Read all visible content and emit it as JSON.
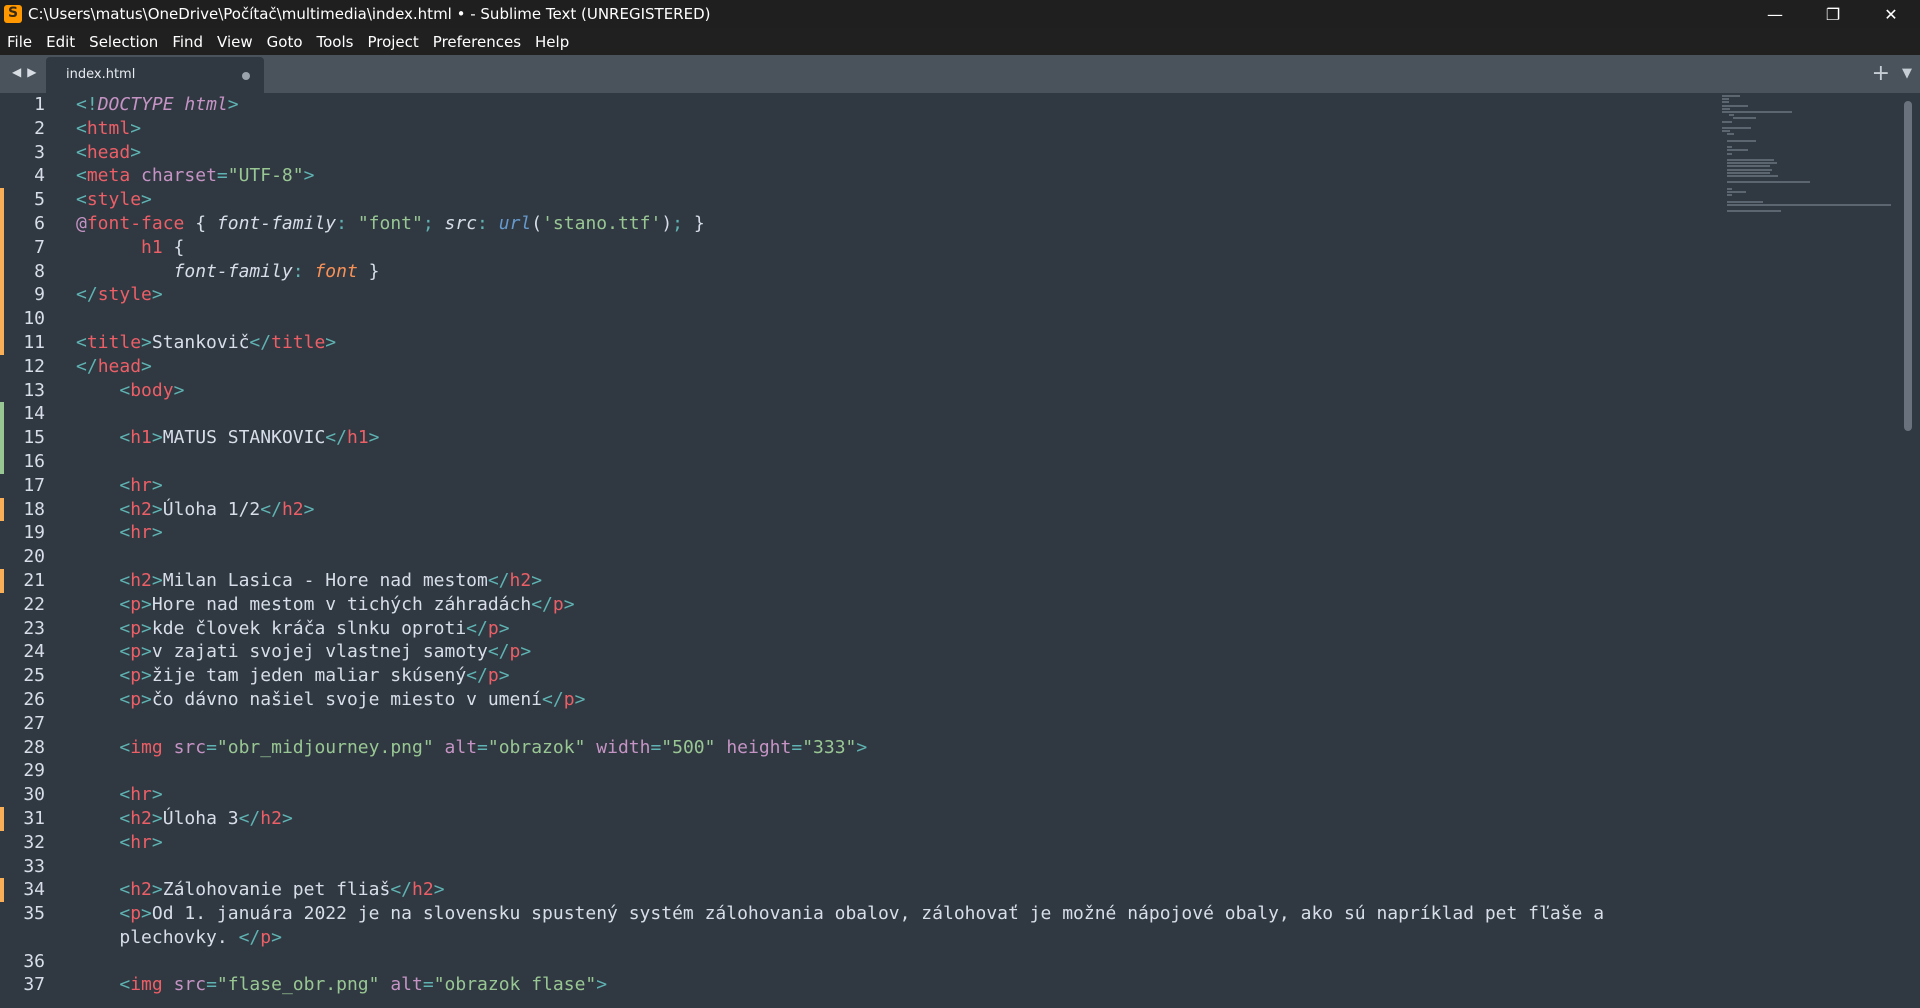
{
  "window": {
    "title": "C:\\Users\\matus\\OneDrive\\Počítač\\multimedia\\index.html • - Sublime Text (UNREGISTERED)",
    "minimize": "—",
    "maximize": "❐",
    "close": "✕"
  },
  "menu": [
    "File",
    "Edit",
    "Selection",
    "Find",
    "View",
    "Goto",
    "Tools",
    "Project",
    "Preferences",
    "Help"
  ],
  "tabs": {
    "active": "index.html",
    "back": "◀",
    "forward": "▶",
    "new_tab": "+",
    "tab_menu": "▼"
  },
  "colors": {
    "background": "#303841",
    "tag": "#ec5f67",
    "punctuation": "#5fb3b3",
    "attribute": "#c594c5",
    "string": "#99c794",
    "function": "#6699cc",
    "modified_marker": "#f9ae58",
    "added_marker": "#99c794"
  },
  "code": [
    {
      "n": "1",
      "m": "",
      "t": "<!DOCTYPE html>"
    },
    {
      "n": "2",
      "m": "",
      "t": "<html>"
    },
    {
      "n": "3",
      "m": "",
      "t": "<head>"
    },
    {
      "n": "4",
      "m": "",
      "t": "<meta charset=\"UTF-8\">"
    },
    {
      "n": "5",
      "m": "mod",
      "t": "<style>"
    },
    {
      "n": "6",
      "m": "mod",
      "t": "@font-face { font-family: \"font\"; src: url('stano.ttf'); }"
    },
    {
      "n": "7",
      "m": "mod",
      "t": "      h1 {"
    },
    {
      "n": "8",
      "m": "mod",
      "t": "         font-family: font }"
    },
    {
      "n": "9",
      "m": "mod",
      "t": "</style>"
    },
    {
      "n": "10",
      "m": "mod",
      "t": ""
    },
    {
      "n": "11",
      "m": "mod",
      "t": "<title>Stankovič</title>"
    },
    {
      "n": "12",
      "m": "",
      "t": "</head>"
    },
    {
      "n": "13",
      "m": "",
      "t": "    <body>"
    },
    {
      "n": "14",
      "m": "add",
      "t": ""
    },
    {
      "n": "15",
      "m": "add",
      "t": "    <h1>MATUS STANKOVIC</h1>"
    },
    {
      "n": "16",
      "m": "add",
      "t": ""
    },
    {
      "n": "17",
      "m": "",
      "t": "    <hr>"
    },
    {
      "n": "18",
      "m": "mod",
      "t": "    <h2>Úloha 1/2</h2>"
    },
    {
      "n": "19",
      "m": "",
      "t": "    <hr>"
    },
    {
      "n": "20",
      "m": "",
      "t": ""
    },
    {
      "n": "21",
      "m": "mod",
      "t": "    <h2>Milan Lasica - Hore nad mestom</h2>"
    },
    {
      "n": "22",
      "m": "",
      "t": "    <p>Hore nad mestom v tichých záhradách</p>"
    },
    {
      "n": "23",
      "m": "",
      "t": "    <p>kde človek kráča slnku oproti</p>"
    },
    {
      "n": "24",
      "m": "",
      "t": "    <p>v zajati svojej vlastnej samoty</p>"
    },
    {
      "n": "25",
      "m": "",
      "t": "    <p>žije tam jeden maliar skúsený</p>"
    },
    {
      "n": "26",
      "m": "",
      "t": "    <p>čo dávno našiel svoje miesto v umení</p>"
    },
    {
      "n": "27",
      "m": "",
      "t": ""
    },
    {
      "n": "28",
      "m": "",
      "t": "    <img src=\"obr_midjourney.png\" alt=\"obrazok\" width=\"500\" height=\"333\">"
    },
    {
      "n": "29",
      "m": "",
      "t": ""
    },
    {
      "n": "30",
      "m": "",
      "t": "    <hr>"
    },
    {
      "n": "31",
      "m": "mod",
      "t": "    <h2>Úloha 3</h2>"
    },
    {
      "n": "32",
      "m": "",
      "t": "    <hr>"
    },
    {
      "n": "33",
      "m": "",
      "t": ""
    },
    {
      "n": "34",
      "m": "mod",
      "t": "    <h2>Zálohovanie pet fliaš</h2>"
    },
    {
      "n": "35",
      "m": "",
      "t": "    <p>Od 1. januára 2022 je na slovensku spustený systém zálohovania obalov, zálohovať je možné nápojové obaly, ako sú napríklad pet fľaše a\n    plechovky. </p>"
    },
    {
      "n": "36",
      "m": "",
      "t": ""
    },
    {
      "n": "37",
      "m": "",
      "t": "    <img src=\"flase_obr.png\" alt=\"obrazok flase\">"
    }
  ]
}
